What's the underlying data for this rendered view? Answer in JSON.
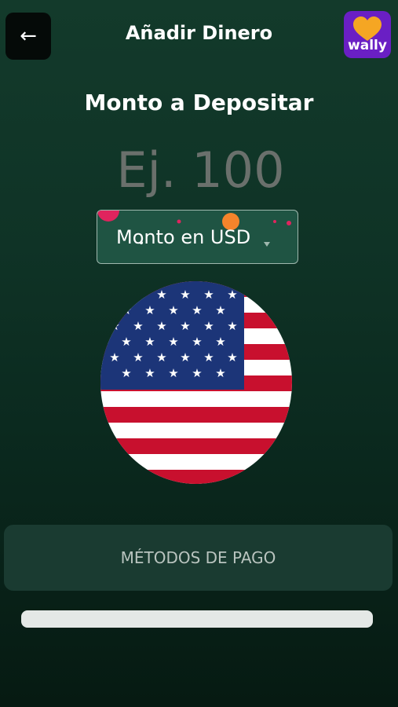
{
  "header": {
    "back_icon": "←",
    "title": "Añadir Dinero",
    "logo_text": "wally"
  },
  "deposit": {
    "title": "Monto a Depositar",
    "amount_placeholder": "Ej. 100",
    "amount_value": "",
    "currency_label": "Monto en USD",
    "currency_flag": "us-flag-icon"
  },
  "payment_methods": {
    "label": "MÉTODOS DE PAGO"
  },
  "colors": {
    "background_top": "#133a2b",
    "background_bottom": "#061a12",
    "logo_purple": "#6a1fc4",
    "logo_orange": "#f5a623",
    "select_bg": "#1f5443",
    "card_bg": "#1a3b31"
  }
}
